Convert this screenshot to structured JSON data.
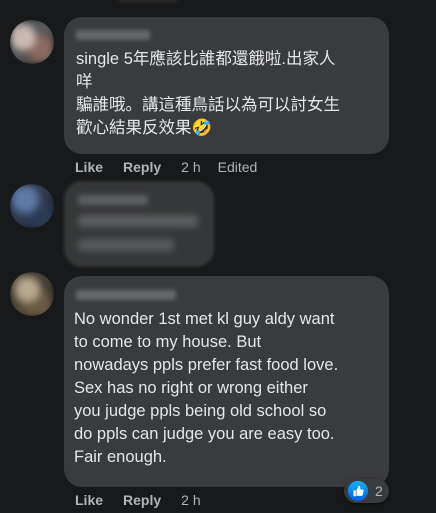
{
  "comments": [
    {
      "text": "single 5年應該比誰都還餓啦.出家人\n咩\n騙誰哦。講這種鳥話以為可以討女生\n歡心結果反效果🤣",
      "actions": {
        "like": "Like",
        "reply": "Reply",
        "time": "2 h",
        "edited": "Edited"
      }
    },
    {
      "text": ""
    },
    {
      "text": "No wonder 1st met kl guy aldy want\nto come to my house. But\nnowadays ppls prefer fast food love.\nSex has no right or wrong either\nyou judge ppls being old school so\ndo ppls can judge you are easy too.\nFair enough.",
      "actions": {
        "like": "Like",
        "reply": "Reply",
        "time": "2 h"
      },
      "reactions": {
        "icon": "thumbs-up-icon",
        "count": "2"
      }
    }
  ],
  "colors": {
    "background": "#18191a",
    "bubble": "#3a3b3c",
    "text": "#e4e6eb",
    "meta": "#b0b3b8",
    "like_blue": "#1877f2"
  }
}
